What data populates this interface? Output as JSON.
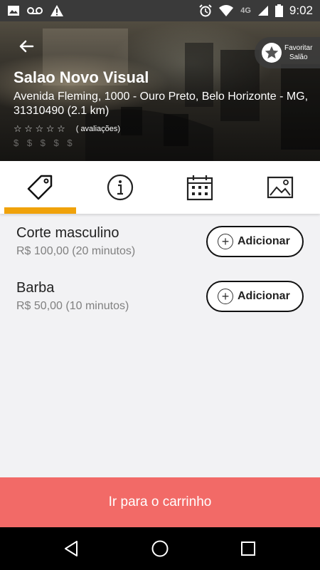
{
  "status_bar": {
    "time": "9:02",
    "network": "4G",
    "icons": [
      "image-icon",
      "voicemail-icon",
      "warning-icon",
      "alarm-icon",
      "wifi-icon",
      "signal-icon",
      "battery-icon"
    ]
  },
  "header": {
    "back_icon": "arrow-left-icon",
    "favorite_line1": "Favoritar",
    "favorite_line2": "Salão",
    "salon_name": "Salao Novo Visual",
    "address": "Avenida Fleming, 1000 - Ouro Preto, Belo Horizonte - MG, 31310490 (2.1 km)",
    "rating_stars": "☆ ☆ ☆ ☆ ☆",
    "rating_count": "( avaliações)",
    "price_level": "$ $ $ $ $"
  },
  "tabs": [
    {
      "name": "services",
      "icon": "tag-icon",
      "active": true
    },
    {
      "name": "info",
      "icon": "info-icon",
      "active": false
    },
    {
      "name": "schedule",
      "icon": "calendar-icon",
      "active": false
    },
    {
      "name": "gallery",
      "icon": "image-icon",
      "active": false
    }
  ],
  "services": [
    {
      "name": "Corte masculino",
      "meta": "R$ 100,00 (20 minutos)",
      "button": "Adicionar"
    },
    {
      "name": "Barba",
      "meta": "R$ 50,00 (10 minutos)",
      "button": "Adicionar"
    }
  ],
  "cart": {
    "label": "Ir para o carrinho"
  },
  "colors": {
    "accent": "#f0a20a",
    "cart": "#f26a67",
    "statusbar": "#3a3a3a"
  }
}
